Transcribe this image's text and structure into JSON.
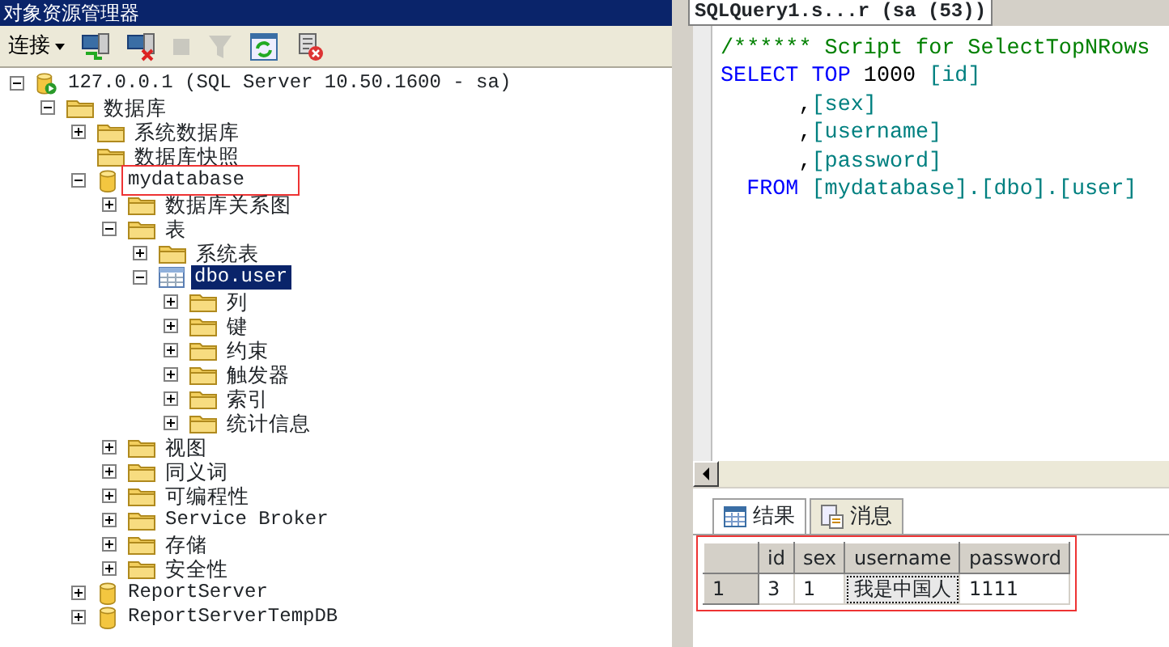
{
  "explorer": {
    "title": "对象资源管理器",
    "toolbar": [
      {
        "kind": "connect-menu",
        "label": "连接",
        "disabled": false
      },
      {
        "kind": "connect",
        "disabled": false
      },
      {
        "kind": "disconnect",
        "disabled": false
      },
      {
        "kind": "stop",
        "disabled": true
      },
      {
        "kind": "filter",
        "disabled": true
      },
      {
        "kind": "refresh",
        "disabled": false
      },
      {
        "kind": "stop-script",
        "disabled": false
      }
    ],
    "tree": [
      {
        "label": "127.0.0.1 (SQL Server 10.50.1600 - sa)",
        "kind": "server",
        "expanded": true,
        "selected": false,
        "highlighted": false,
        "children": [
          {
            "label": "数据库",
            "kind": "folder",
            "expanded": true,
            "selected": false,
            "highlighted": false,
            "children": [
              {
                "label": "系统数据库",
                "kind": "folder",
                "expanded": false,
                "selected": false,
                "highlighted": false
              },
              {
                "label": "数据库快照",
                "kind": "folder",
                "selected": false,
                "highlighted": false
              },
              {
                "label": "mydatabase",
                "kind": "database",
                "expanded": true,
                "selected": false,
                "highlighted": true,
                "children": [
                  {
                    "label": "数据库关系图",
                    "kind": "folder",
                    "expanded": false,
                    "selected": false,
                    "highlighted": false
                  },
                  {
                    "label": "表",
                    "kind": "folder",
                    "expanded": true,
                    "selected": false,
                    "highlighted": false,
                    "children": [
                      {
                        "label": "系统表",
                        "kind": "folder",
                        "expanded": false,
                        "selected": false,
                        "highlighted": false
                      },
                      {
                        "label": "dbo.user",
                        "kind": "table",
                        "expanded": true,
                        "selected": true,
                        "highlighted": false,
                        "children": [
                          {
                            "label": "列",
                            "kind": "folder",
                            "expanded": false,
                            "selected": false,
                            "highlighted": false
                          },
                          {
                            "label": "键",
                            "kind": "folder",
                            "expanded": false,
                            "selected": false,
                            "highlighted": false
                          },
                          {
                            "label": "约束",
                            "kind": "folder",
                            "expanded": false,
                            "selected": false,
                            "highlighted": false
                          },
                          {
                            "label": "触发器",
                            "kind": "folder",
                            "expanded": false,
                            "selected": false,
                            "highlighted": false
                          },
                          {
                            "label": "索引",
                            "kind": "folder",
                            "expanded": false,
                            "selected": false,
                            "highlighted": false
                          },
                          {
                            "label": "统计信息",
                            "kind": "folder",
                            "expanded": false,
                            "selected": false,
                            "highlighted": false
                          }
                        ]
                      }
                    ]
                  },
                  {
                    "label": "视图",
                    "kind": "folder",
                    "expanded": false,
                    "selected": false,
                    "highlighted": false
                  },
                  {
                    "label": "同义词",
                    "kind": "folder",
                    "expanded": false,
                    "selected": false,
                    "highlighted": false
                  },
                  {
                    "label": "可编程性",
                    "kind": "folder",
                    "expanded": false,
                    "selected": false,
                    "highlighted": false
                  },
                  {
                    "label": "Service Broker",
                    "kind": "folder",
                    "expanded": false,
                    "selected": false,
                    "highlighted": false
                  },
                  {
                    "label": "存储",
                    "kind": "folder",
                    "expanded": false,
                    "selected": false,
                    "highlighted": false
                  },
                  {
                    "label": "安全性",
                    "kind": "folder",
                    "expanded": false,
                    "selected": false,
                    "highlighted": false
                  }
                ]
              },
              {
                "label": "ReportServer",
                "kind": "database",
                "expanded": false,
                "selected": false,
                "highlighted": false
              },
              {
                "label": "ReportServerTempDB",
                "kind": "database",
                "expanded": false,
                "selected": false,
                "highlighted": false
              }
            ]
          }
        ]
      }
    ]
  },
  "editor": {
    "tab": "SQLQuery1.s...r (sa (53))",
    "lines": [
      [
        {
          "kind": "comment",
          "text": "/****** Script for SelectTopNRows"
        }
      ],
      [
        {
          "kind": "keyword",
          "text": "SELECT TOP "
        },
        {
          "kind": "plain",
          "text": "1000 "
        },
        {
          "kind": "ident",
          "text": "[id]"
        }
      ],
      [
        {
          "kind": "plain",
          "text": "      ,"
        },
        {
          "kind": "ident",
          "text": "[sex]"
        }
      ],
      [
        {
          "kind": "plain",
          "text": "      ,"
        },
        {
          "kind": "ident",
          "text": "[username]"
        }
      ],
      [
        {
          "kind": "plain",
          "text": "      ,"
        },
        {
          "kind": "ident",
          "text": "[password]"
        }
      ],
      [
        {
          "kind": "keyword",
          "text": "  FROM "
        },
        {
          "kind": "ident",
          "text": "[mydatabase].[dbo].[user]"
        }
      ]
    ],
    "result_tabs": [
      {
        "label": "结果",
        "kind": "grid",
        "selected": true
      },
      {
        "label": "消息",
        "kind": "messages",
        "selected": false
      }
    ],
    "results": {
      "highlighted": true,
      "columns": [
        "id",
        "sex",
        "username",
        "password"
      ],
      "rows": [
        {
          "number": "1",
          "cells": [
            {
              "text": "3",
              "selected": false
            },
            {
              "text": "1",
              "selected": false
            },
            {
              "text": "我是中国人",
              "selected": true
            },
            {
              "text": "1111",
              "selected": false
            }
          ]
        }
      ]
    }
  }
}
